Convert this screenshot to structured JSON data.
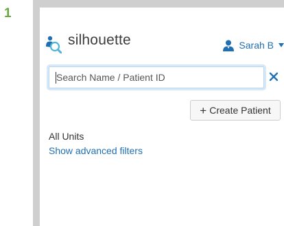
{
  "step": {
    "number": "1"
  },
  "header": {
    "app_name": "silhouette",
    "logo_icon": "person-search-icon",
    "user": {
      "name": "Sarah B",
      "icon": "user-icon",
      "menu_icon": "caret-down-icon"
    }
  },
  "search": {
    "placeholder": "Search Name / Patient ID",
    "value": "",
    "clear_icon": "close-icon"
  },
  "actions": {
    "create_patient_label": "Create Patient",
    "create_patient_icon": "plus-icon"
  },
  "filters": {
    "units_label": "All Units",
    "advanced_link": "Show advanced filters"
  },
  "colors": {
    "accent": "#1f6fb3",
    "step": "#6aa63f",
    "frame": "#cfcfcf",
    "search_focus": "#d7e9f8"
  }
}
